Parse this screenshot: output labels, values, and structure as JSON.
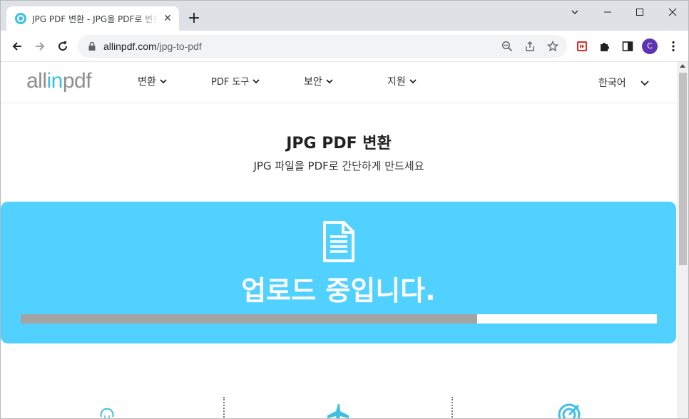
{
  "browser": {
    "tab_title": "JPG PDF 변환 - JPG을 PDF로 변환",
    "tab_close": "✕",
    "new_tab": "+",
    "url_host": "allinpdf.com",
    "url_path": "/jpg-to-pdf",
    "profile_initial": "C"
  },
  "site": {
    "logo_pre": "all",
    "logo_mid": "in",
    "logo_post": "pdf",
    "nav": [
      {
        "label": "변환"
      },
      {
        "label": "PDF 도구"
      },
      {
        "label": "보안"
      },
      {
        "label": "지원"
      }
    ],
    "language": "한국어"
  },
  "hero": {
    "title": "JPG PDF 변환",
    "subtitle": "JPG 파일을 PDF로 간단하게 만드세요"
  },
  "upload": {
    "status": "업로드 중입니다.",
    "progress": 0.717
  },
  "colors": {
    "accent": "#3fc0e2",
    "panel": "#50d1ff",
    "progress_fill": "#a3a3a3"
  },
  "icons": [
    "search-icon",
    "back-arrow-icon",
    "forward-arrow-icon",
    "reload-icon",
    "lock-icon",
    "zoom-out-icon",
    "share-icon",
    "star-icon",
    "extension-icon",
    "puzzle-icon",
    "side-panel-icon",
    "more-icon",
    "document-icon",
    "lightbulb-icon",
    "airplane-icon",
    "target-icon"
  ]
}
